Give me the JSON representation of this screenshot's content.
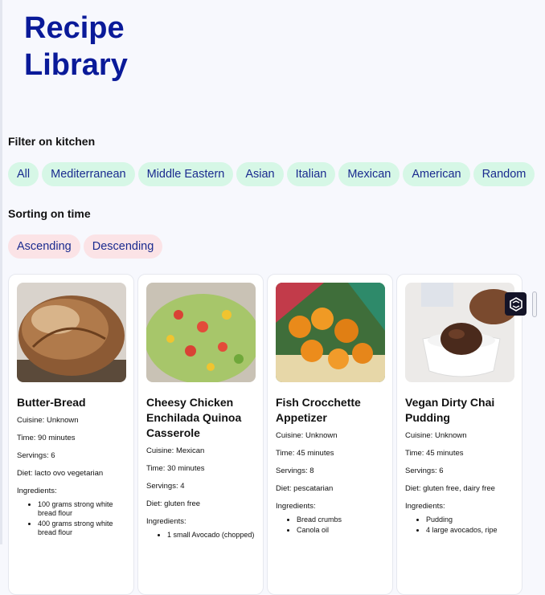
{
  "header": {
    "title": "Recipe Library"
  },
  "filter": {
    "label": "Filter on kitchen",
    "options": [
      "All",
      "Mediterranean",
      "Middle Eastern",
      "Asian",
      "Italian",
      "Mexican",
      "American",
      "Random"
    ]
  },
  "sorting": {
    "label": "Sorting on time",
    "options": [
      "Ascending",
      "Descending"
    ]
  },
  "recipes": [
    {
      "title": "Butter-Bread",
      "cuisine": "Cuisine: Unknown",
      "time": "Time: 90 minutes",
      "servings": "Servings: 6",
      "diet": "Diet: lacto ovo vegetarian",
      "ingredients_label": "Ingredients:",
      "ingredients": [
        "100 grams strong white bread flour",
        "400 grams strong white bread flour"
      ]
    },
    {
      "title": "Cheesy Chicken Enchilada Quinoa Casserole",
      "cuisine": "Cuisine: Mexican",
      "time": "Time: 30 minutes",
      "servings": "Servings: 4",
      "diet": "Diet: gluten free",
      "ingredients_label": "Ingredients:",
      "ingredients": [
        "1 small Avocado (chopped)"
      ]
    },
    {
      "title": "Fish Crocchette Appetizer",
      "cuisine": "Cuisine: Unknown",
      "time": "Time: 45 minutes",
      "servings": "Servings: 8",
      "diet": "Diet: pescatarian",
      "ingredients_label": "Ingredients:",
      "ingredients": [
        "Bread crumbs",
        "Canola oil"
      ]
    },
    {
      "title": "Vegan Dirty Chai Pudding",
      "cuisine": "Cuisine: Unknown",
      "time": "Time: 45 minutes",
      "servings": "Servings: 6",
      "diet": "Diet: gluten free, dairy free",
      "ingredients_label": "Ingredients:",
      "ingredients": [
        "Pudding",
        "4 large avocados, ripe"
      ]
    }
  ],
  "colors": {
    "title": "#0a1a99",
    "chip_filter_bg": "#d6f7e6",
    "chip_sort_bg": "#fbe3e6",
    "chip_text": "#1a2b8f"
  },
  "icons": {
    "floating_button": "sparkle-logo-icon"
  }
}
